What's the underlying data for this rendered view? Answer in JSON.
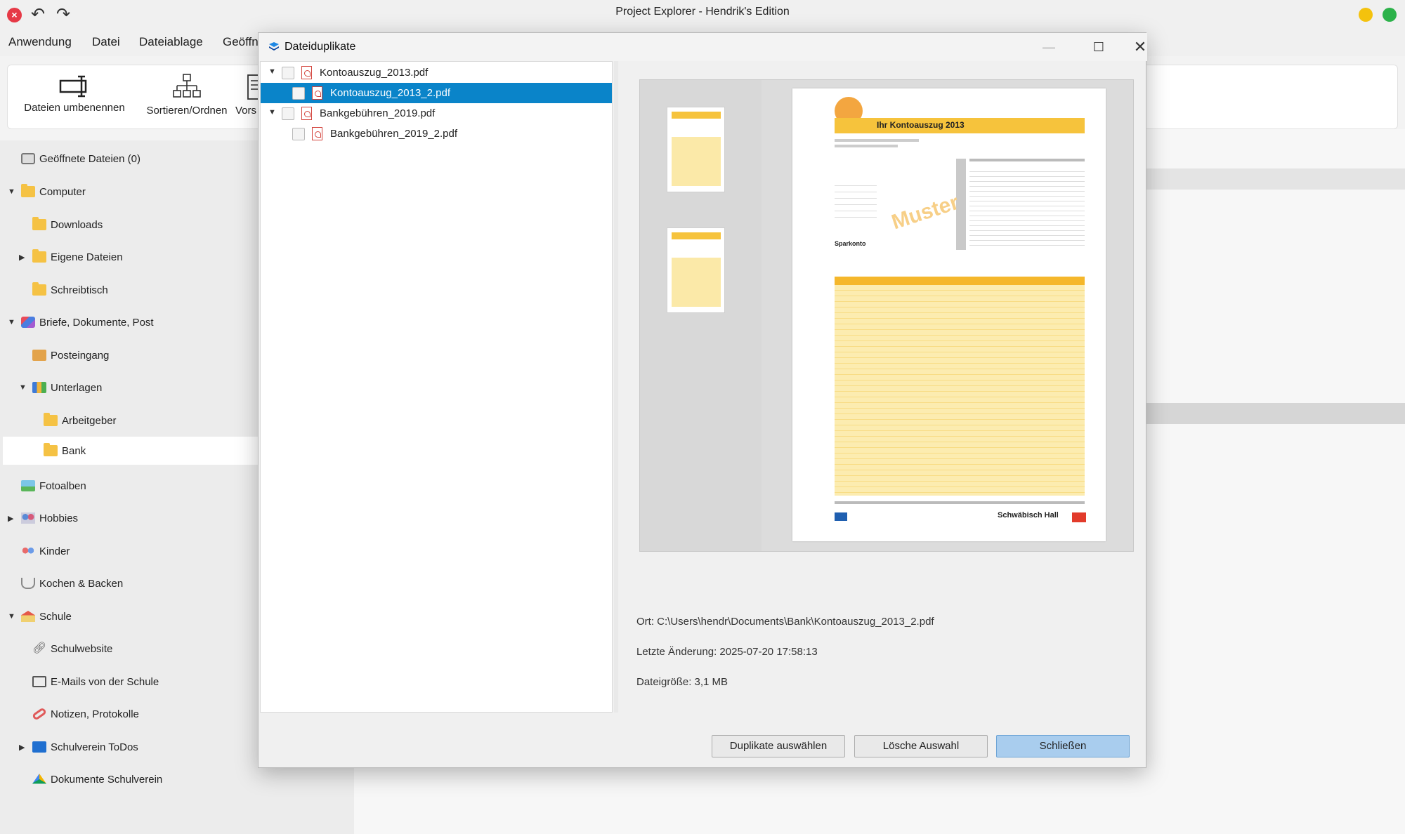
{
  "app": {
    "title": "Project Explorer - Hendrik's Edition"
  },
  "menu": [
    "Anwendung",
    "Datei",
    "Dateiablage",
    "Geöffn"
  ],
  "ribbon": {
    "rename": "Dateien umbenennen",
    "sort": "Sortieren/Ordnen",
    "partial": "Vors"
  },
  "sidebar": {
    "items": [
      {
        "label": "Geöffnete Dateien (0)",
        "icon": "stack-icon"
      },
      {
        "label": "Computer",
        "icon": "folder-icon"
      },
      {
        "label": "Downloads",
        "icon": "folder-icon"
      },
      {
        "label": "Eigene Dateien",
        "icon": "folder-icon"
      },
      {
        "label": "Schreibtisch",
        "icon": "folder-icon"
      },
      {
        "label": "Briefe, Dokumente, Post",
        "icon": "cube-icon"
      },
      {
        "label": "Posteingang",
        "icon": "inbox-icon"
      },
      {
        "label": "Unterlagen",
        "icon": "binder-icon"
      },
      {
        "label": "Arbeitgeber",
        "icon": "folder-icon"
      },
      {
        "label": "Bank",
        "icon": "folder-icon"
      },
      {
        "label": "Fotoalben",
        "icon": "photo-icon"
      },
      {
        "label": "Hobbies",
        "icon": "people-icon"
      },
      {
        "label": "Kinder",
        "icon": "kids-icon"
      },
      {
        "label": "Kochen & Backen",
        "icon": "cooking-pot-icon"
      },
      {
        "label": "Schule",
        "icon": "school-icon"
      },
      {
        "label": "Schulwebsite",
        "icon": "link-icon"
      },
      {
        "label": "E-Mails von der Schule",
        "icon": "mail-icon"
      },
      {
        "label": "Notizen, Protokolle",
        "icon": "paperclip-icon"
      },
      {
        "label": "Schulverein ToDos",
        "icon": "todo-icon"
      },
      {
        "label": "Dokumente Schulverein",
        "icon": "drive-icon"
      }
    ]
  },
  "dialog": {
    "title": "Dateiduplikate",
    "tree": [
      {
        "label": "Kontoauszug_2013.pdf"
      },
      {
        "label": "Kontoauszug_2013_2.pdf"
      },
      {
        "label": "Bankgebühren_2019.pdf"
      },
      {
        "label": "Bankgebühren_2019_2.pdf"
      }
    ],
    "preview": {
      "header": "Ihr Kontoauszug 2013",
      "watermark": "Muster",
      "section": "Sparkonto",
      "brand": "Schwäbisch Hall"
    },
    "info": {
      "location": "Ort: C:\\Users\\hendr\\Documents\\Bank\\Kontoauszug_2013_2.pdf",
      "modified": "Letzte Änderung: 2025-07-20 17:58:13",
      "size": "Dateigröße: 3,1 MB"
    },
    "buttons": {
      "select_duplicates": "Duplikate auswählen",
      "delete_selection": "Lösche Auswahl",
      "close": "Schließen"
    }
  },
  "colors": {
    "selection": "#0a84c9",
    "primary_button": "#a9cdee",
    "folder": "#f5c244",
    "pdf_red": "#d3433c"
  }
}
